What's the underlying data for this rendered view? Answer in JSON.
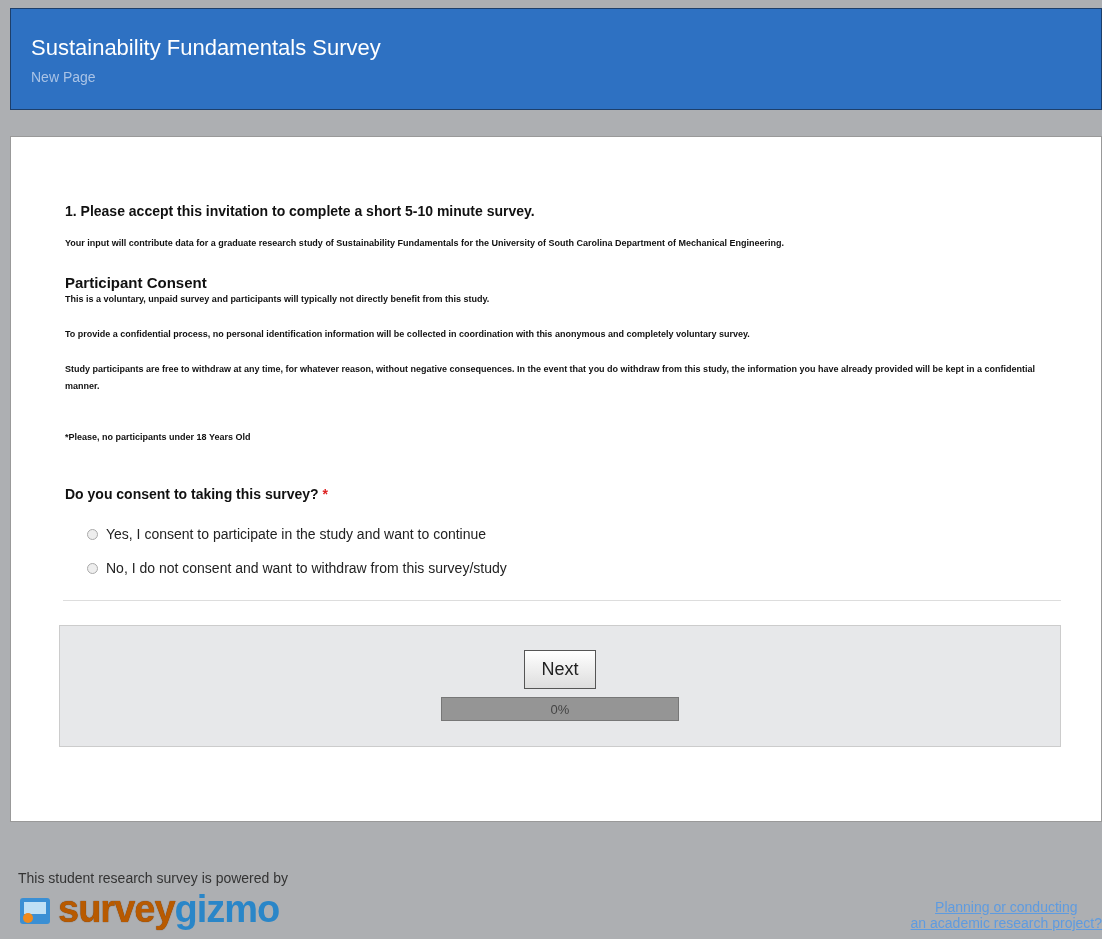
{
  "header": {
    "title": "Sustainability Fundamentals Survey",
    "subtitle": "New Page"
  },
  "question_1": {
    "title": "1. Please accept this invitation to complete a short 5-10 minute survey.",
    "intro": "Your input will contribute data for a graduate research study of Sustainability Fundamentals for the University of South Carolina Department of Mechanical Engineering.",
    "section_heading": "Participant Consent",
    "paragraphs": [
      "This is a voluntary, unpaid survey and participants will typically not directly benefit from this study.",
      "To provide a confidential process, no personal identification information will be collected in coordination with this anonymous and completely voluntary survey.",
      "Study participants are free to withdraw at any time, for whatever reason, without negative consequences. In the event that you do withdraw from this study, the information you have already provided will be kept in a confidential manner."
    ],
    "note": "*Please, no participants under 18 Years Old"
  },
  "question_2": {
    "title": "Do you consent to taking this survey?",
    "required_mark": "*",
    "options": [
      {
        "label": "Yes, I consent to participate in the study and want to continue",
        "selected": false
      },
      {
        "label": "No, I do not consent and want to withdraw from this survey/study",
        "selected": false
      }
    ]
  },
  "footer_panel": {
    "button": "Next",
    "progress": {
      "level": 0,
      "reading": "0%"
    }
  },
  "page_footer": {
    "powered_by": "This student research survey is powered by",
    "logo": {
      "part_1": "survey",
      "part_2": "gizmo"
    },
    "link_lines": [
      "Planning or conducting",
      "an academic research project?"
    ]
  }
}
